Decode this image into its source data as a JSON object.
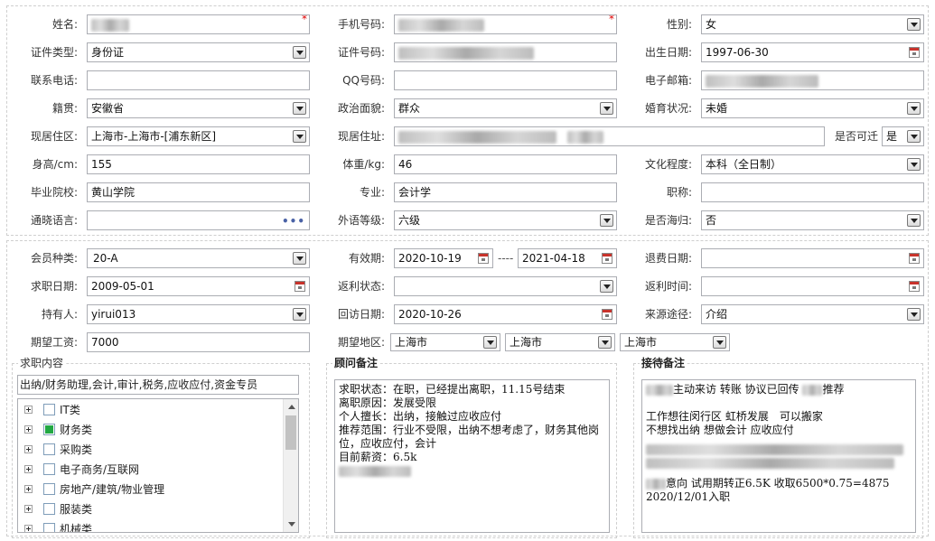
{
  "basic": {
    "name": {
      "label": "姓名:",
      "required": "*"
    },
    "mobile": {
      "label": "手机号码:",
      "required": "*"
    },
    "gender": {
      "label": "性别:",
      "value": "女"
    },
    "id_type": {
      "label": "证件类型:",
      "value": "身份证"
    },
    "id_no": {
      "label": "证件号码:"
    },
    "birth": {
      "label": "出生日期:",
      "value": "1997-06-30"
    },
    "phone": {
      "label": "联系电话:"
    },
    "qq": {
      "label": "QQ号码:"
    },
    "email": {
      "label": "电子邮箱:"
    },
    "native": {
      "label": "籍贯:",
      "value": "安徽省"
    },
    "political": {
      "label": "政治面貌:",
      "value": "群众"
    },
    "marital": {
      "label": "婚育状况:",
      "value": "未婚"
    },
    "residence": {
      "label": "现居住区:",
      "value": "上海市-上海市-[浦东新区]"
    },
    "address": {
      "label": "现居住址:"
    },
    "relocate": {
      "label": "是否可迁",
      "value": "是"
    },
    "height": {
      "label": "身高/cm:",
      "value": "155"
    },
    "weight": {
      "label": "体重/kg:",
      "value": "46"
    },
    "education": {
      "label": "文化程度:",
      "value": "本科（全日制）"
    },
    "school": {
      "label": "毕业院校:",
      "value": "黄山学院"
    },
    "major": {
      "label": "专业:",
      "value": "会计学"
    },
    "title": {
      "label": "职称:"
    },
    "language": {
      "label": "通晓语言:",
      "dots": "•••"
    },
    "foreign": {
      "label": "外语等级:",
      "value": "六级"
    },
    "returnee": {
      "label": "是否海归:",
      "value": "否"
    }
  },
  "member": {
    "type": {
      "label": "会员种类:",
      "value": "20-A"
    },
    "valid": {
      "label": "有效期:",
      "from": "2020-10-19",
      "sep": "----",
      "to": "2021-04-18"
    },
    "refund_date": {
      "label": "退费日期:"
    },
    "job_date": {
      "label": "求职日期:",
      "value": "2009-05-01"
    },
    "rebate_status": {
      "label": "返利状态:"
    },
    "rebate_time": {
      "label": "返利时间:"
    },
    "holder": {
      "label": "持有人:",
      "value": "yirui013"
    },
    "visit_date": {
      "label": "回访日期:",
      "value": "2020-10-26"
    },
    "source": {
      "label": "来源途径:",
      "value": "介绍"
    },
    "salary": {
      "label": "期望工资:",
      "value": "7000"
    },
    "area": {
      "label": "期望地区:",
      "v1": "上海市",
      "v2": "上海市",
      "v3": "上海市"
    }
  },
  "job": {
    "title": "求职内容",
    "selected": "出纳/财务助理,会计,审计,税务,应收应付,资金专员",
    "tree": [
      {
        "label": "IT类",
        "checked": false
      },
      {
        "label": "财务类",
        "checked": true
      },
      {
        "label": "采购类",
        "checked": false
      },
      {
        "label": "电子商务/互联网",
        "checked": false
      },
      {
        "label": "房地产/建筑/物业管理",
        "checked": false
      },
      {
        "label": "服装类",
        "checked": false
      },
      {
        "label": "机械类",
        "checked": false
      }
    ]
  },
  "advisor": {
    "title": "顾问备注",
    "l1": "求职状态：在职，已经提出离职，11.15号结束",
    "l2": "离职原因：发展受限",
    "l3": "个人擅长：出纳，接触过应收应付",
    "l4": "推荐范围：行业不受限，出纳不想考虑了，财务其他岗位，应收应付，会计",
    "l5": "目前薪资：6.5k"
  },
  "reception": {
    "title": "接待备注",
    "l1": "主动来访 转账 协议已回传",
    "l1b": "推荐",
    "l2": "工作想往闵行区 虹桥发展　可以搬家",
    "l3": "不想找出纳 想做会计 应收应付",
    "l4": "意向 试用期转正6.5K 收取6500*0.75=4875",
    "l5": "2020/12/01入职"
  }
}
